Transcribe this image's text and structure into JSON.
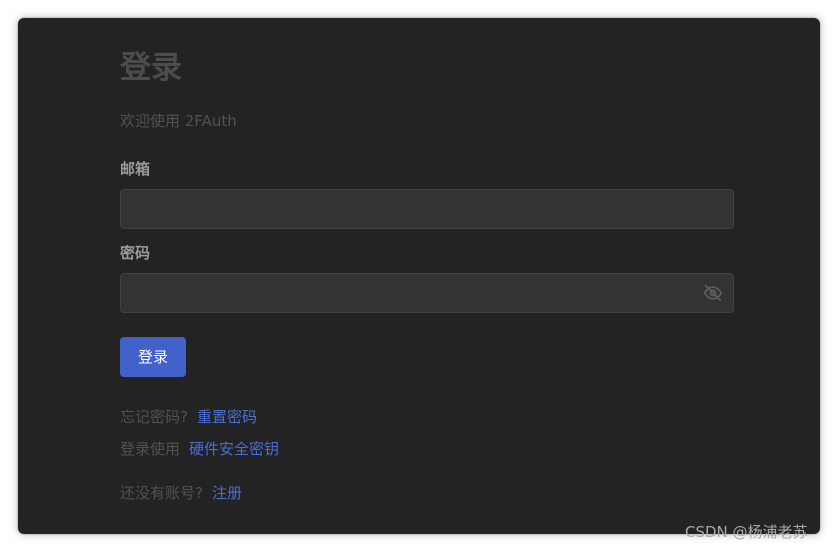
{
  "login": {
    "title": "登录",
    "subtitle": "欢迎使用 2FAuth",
    "email": {
      "label": "邮箱",
      "value": "",
      "placeholder": ""
    },
    "password": {
      "label": "密码",
      "value": "",
      "placeholder": "",
      "visibility_icon": "eye-slash-icon"
    },
    "submit_label": "登录",
    "forgot": {
      "prompt": "忘记密码?",
      "link": "重置密码"
    },
    "webauthn": {
      "prompt": "登录使用",
      "link": "硬件安全密钥"
    },
    "register": {
      "prompt": "还没有账号?",
      "link": "注册"
    }
  },
  "watermark": "CSDN @杨浦老苏",
  "colors": {
    "window_bg": "#232323",
    "input_bg": "#333333",
    "primary_button": "#4261c9",
    "link": "#4a6fd6",
    "muted_text": "#515151"
  }
}
